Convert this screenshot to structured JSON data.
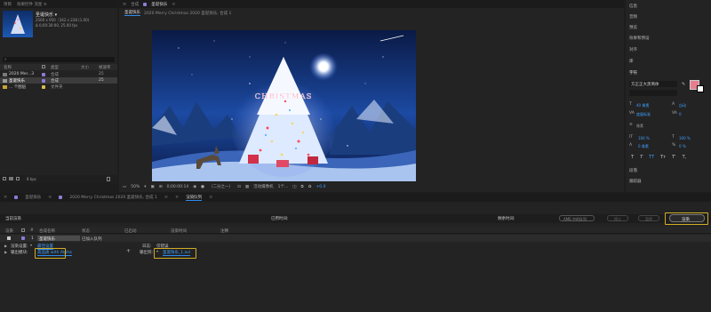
{
  "colors": {
    "accent": "#2d8ceb",
    "highlight": "#d2ad25",
    "label_purple": "#8f7ad6",
    "label_yellow": "#d6c14a",
    "pink": "#e67e8e"
  },
  "project": {
    "tabs": [
      "项目",
      "效果控件 流星 ≡"
    ],
    "comp_name": "圣诞快乐 ▾",
    "comp_size": "2560 x 950（342 x 228 (1.00)",
    "comp_duration": "Δ 0;00:30:00, 25.00 fps",
    "columns": [
      "名称",
      "类型",
      "大小",
      "帧速率"
    ],
    "items": [
      {
        "name": "2020 Mer...3",
        "type": "合成",
        "size": "",
        "fps": "25"
      },
      {
        "name": "圣诞快乐",
        "type": "合成",
        "size": "",
        "fps": "25"
      },
      {
        "name": "... 个图层",
        "type": "文件夹",
        "size": "",
        "fps": ""
      }
    ],
    "footer_bpc": "8 bpc"
  },
  "viewer": {
    "tabs": [
      "圣诞快乐",
      "2020 Merry Christmas 2020 圣诞快乐, 合成 1"
    ],
    "panel_title": "合成",
    "layer_label": "圣诞快乐",
    "image_text": "CHRISTMAS",
    "footer": {
      "zoom": "50%",
      "timecode": "0;00:00:14",
      "resolution": "（二分之一）",
      "camera": "活动摄像机",
      "views": "1个...",
      "exposure": "+0.0"
    }
  },
  "right_panel": {
    "items": [
      "信息",
      "音频",
      "预览",
      "效果和预设",
      "对齐",
      "库",
      "字符"
    ],
    "font": "方正正大黑简体",
    "font_size": "40 像素",
    "leading": "自动",
    "kerning": "度量标准",
    "tracking": "0",
    "stroke": "像素",
    "scale_v": "100 %",
    "scale_h": "100 %",
    "baseline": "0 像素",
    "tsume": "0 %",
    "styles": [
      "T",
      "T",
      "TT",
      "Tт",
      "T'",
      "T,"
    ],
    "bottom_items": [
      "段落",
      "跟踪器"
    ]
  },
  "timeline": {
    "tabs": [
      "圣诞快乐",
      "2020 Merry Christmas 2020 圣诞快乐, 合成 1",
      "渲染队列"
    ],
    "current_render": "当前渲染",
    "elapsed": "已用时间:",
    "remaining": "剩余时间:",
    "ame_button": "AME 中的队列",
    "stop_button": "停止",
    "pause_button": "暂停",
    "render_button": "渲染",
    "columns": [
      "渲染",
      "#",
      "合成名称",
      "状态",
      "已启动",
      "渲染时间",
      "注释"
    ],
    "row": {
      "index": "1",
      "comp": "圣诞快乐",
      "status": "已加入队列"
    },
    "render_settings_label": "渲染设置:",
    "render_settings_value": "最佳设置",
    "output_module_label": "输出模块:",
    "output_module_value": "高品质 with Alpha",
    "log_label": "日志:",
    "log_value": "仅错误",
    "output_to_label": "输出到:",
    "output_to_value": "圣诞快乐_1.avi"
  }
}
